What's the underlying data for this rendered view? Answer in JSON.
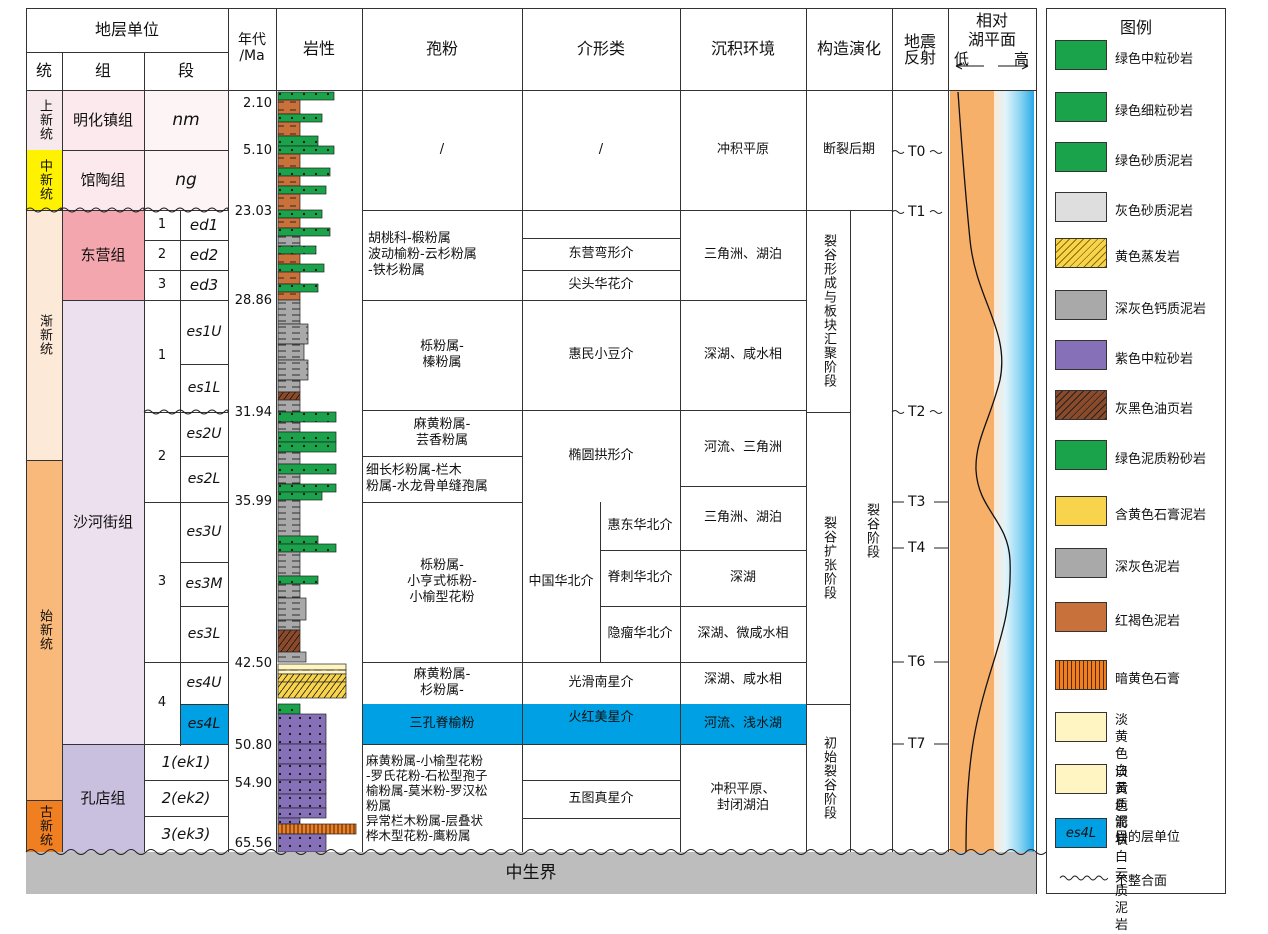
{
  "header": {
    "stratigraphic_unit": "地层单位",
    "series": "统",
    "formation": "组",
    "member": "段",
    "age_line1": "年代",
    "age_line2": "/Ma",
    "lithology": "岩性",
    "sporopollen": "孢粉",
    "ostracod": "介形类",
    "environment": "沉积环境",
    "tectonics": "构造演化",
    "seismic_line1": "地震",
    "seismic_line2": "反射",
    "sea_line1": "相对",
    "sea_line2": "湖平面",
    "sea_low": "低",
    "sea_high": "高"
  },
  "series": [
    "上新统",
    "中新统",
    "渐新统",
    "始新统",
    "古新统"
  ],
  "formations": {
    "minghuazhen": "明化镇组",
    "guantao": "馆陶组",
    "dongying": "东营组",
    "shahejie": "沙河街组",
    "kongdian": "孔店组"
  },
  "members": {
    "nm": "nm",
    "ng": "ng",
    "ed_nums": [
      "1",
      "2",
      "3"
    ],
    "ed1": "ed1",
    "ed2": "ed2",
    "ed3": "ed3",
    "es_nums": [
      "1",
      "2",
      "3",
      "4"
    ],
    "es1U": "es1U",
    "es1L": "es1L",
    "es2U": "es2U",
    "es2L": "es2L",
    "es3U": "es3U",
    "es3M": "es3M",
    "es3L": "es3L",
    "es4U": "es4U",
    "es4L": "es4L",
    "ek1": "1(ek1)",
    "ek2": "2(ek2)",
    "ek3": "3(ek3)"
  },
  "ages": [
    "2.10",
    "5.10",
    "23.03",
    "28.86",
    "31.94",
    "35.99",
    "42.50",
    "50.80",
    "54.90",
    "65.56"
  ],
  "sporopollen": {
    "neogene": "/",
    "dongying": "胡桃科-椴粉属\n波动榆粉-云杉粉属\n-铁杉粉属",
    "es1": "栎粉属-\n榛粉属",
    "es2u": "麻黄粉属-\n芸香粉属",
    "es2l": "细长杉粉属-栏木\n粉属-水龙骨单缝孢属",
    "es3": "栎粉属-\n小亨式栎粉-\n小榆型花粉",
    "es4u": "麻黄粉属-\n杉粉属-",
    "es4l": "三孔脊榆粉",
    "kongdian": "麻黄粉属-小榆型花粉\n-罗氏花粉-石松型孢子\n榆粉属-莫米粉-罗汉松\n粉属\n异常栏木粉属-层叠状\n桦木型花粉-鹰粉属"
  },
  "ostracod": {
    "neogene": "/",
    "ed2": "东营弯形介",
    "ed3": "尖头华花介",
    "es1": "惠民小豆介",
    "es2": "椭圆拱形介",
    "es3_main": "中国华北介",
    "es3_u": "惠东华北介",
    "es3_m": "脊刺华北介",
    "es3_l": "隐瘤华北介",
    "es4u": "光滑南星介",
    "es4l": "火红美星介",
    "kongdian": "五图真星介"
  },
  "environment": {
    "neogene": "冲积平原",
    "dongying": "三角洲、湖泊",
    "es1": "深湖、咸水相",
    "es2": "河流、三角洲",
    "es3u": "三角洲、湖泊",
    "es3m": "深湖",
    "es3l": "深湖、微咸水相",
    "es4u": "深湖、咸水相",
    "es4l": "河流、浅水湖",
    "kongdian": "冲积平原、\n封闭湖泊"
  },
  "tectonics": {
    "post_rift": "断裂后期",
    "rift_convergence": "裂谷形成与板块汇聚阶段",
    "rift": "裂谷阶段",
    "rift_expansion": "裂谷扩张阶段",
    "initial_rift": "初始裂谷阶段"
  },
  "seismic": [
    "T0",
    "T1",
    "T2",
    "T3",
    "T4",
    "T6",
    "T7"
  ],
  "base": "中生界",
  "legend": {
    "title": "图例",
    "items": [
      "绿色中粒砂岩",
      "绿色细粒砂岩",
      "绿色砂质泥岩",
      "灰色砂质泥岩",
      "黄色蒸发岩",
      "深灰色钙质泥岩",
      "紫色中粒砂岩",
      "灰黑色油页岩",
      "绿色泥质粉砂岩",
      "含黄色石膏泥岩",
      "深灰色泥岩",
      "红褐色泥岩",
      "暗黄色石膏",
      "淡黄色\n白云质泥岩",
      "淡黄色箭状\n白云质泥岩",
      "目的层单位",
      "不整合面"
    ],
    "target_swatch": "es4L"
  },
  "colors": {
    "series_pliocene": "#f7e9ec",
    "series_miocene": "#fff200",
    "series_oligocene": "#fde9d7",
    "series_eocene": "#f9b97a",
    "series_paleocene": "#f07f22",
    "formation_neogene": "#fbe9ee",
    "formation_dongying": "#f3a6ad",
    "formation_shahejie": "#ede0ee",
    "formation_kongdian": "#c9bfde",
    "target": "#00a1e4",
    "base": "#bdbdbd",
    "green": "#1aa34a",
    "purple": "#8670b8",
    "redbrown": "#c8713a",
    "gray": "#a9a9a9",
    "yellow": "#f8d44c",
    "sea_orange": "#f7b06a"
  }
}
